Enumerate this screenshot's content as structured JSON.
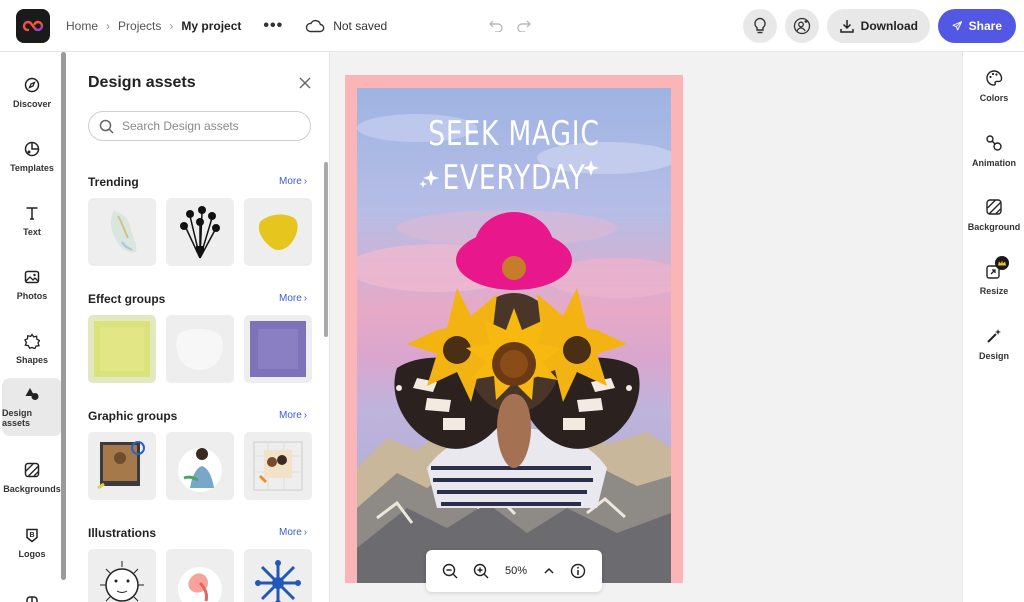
{
  "breadcrumbs": {
    "home": "Home",
    "projects": "Projects",
    "current": "My project",
    "more": "•••",
    "save_status": "Not saved"
  },
  "actions": {
    "download": "Download",
    "share": "Share"
  },
  "left_rail": [
    {
      "label": "Discover",
      "icon": "compass-icon"
    },
    {
      "label": "Templates",
      "icon": "templates-icon"
    },
    {
      "label": "Text",
      "icon": "text-icon"
    },
    {
      "label": "Photos",
      "icon": "photo-icon"
    },
    {
      "label": "Shapes",
      "icon": "shapes-icon"
    },
    {
      "label": "Design assets",
      "icon": "design-assets-icon",
      "active": true
    },
    {
      "label": "Backgrounds",
      "icon": "backgrounds-icon"
    },
    {
      "label": "Logos",
      "icon": "logos-icon"
    }
  ],
  "panel": {
    "title": "Design assets",
    "search_placeholder": "Search Design assets",
    "more_label": "More",
    "sections": [
      {
        "title": "Trending"
      },
      {
        "title": "Effect groups"
      },
      {
        "title": "Graphic groups"
      },
      {
        "title": "Illustrations"
      }
    ]
  },
  "canvas": {
    "headline_line1": "SEEK MAGIC",
    "headline_line2": "EVERYDAY",
    "zoom_level": "50%"
  },
  "right_rail": [
    {
      "label": "Colors",
      "icon": "palette-icon"
    },
    {
      "label": "Animation",
      "icon": "animation-icon"
    },
    {
      "label": "Background",
      "icon": "background-icon"
    },
    {
      "label": "Resize",
      "icon": "resize-icon",
      "premium": true
    },
    {
      "label": "Design",
      "icon": "magic-wand-icon"
    }
  ],
  "colors": {
    "accent": "#5258e4",
    "artboard_border": "#fbb5b6",
    "link": "#3b5bdb"
  }
}
